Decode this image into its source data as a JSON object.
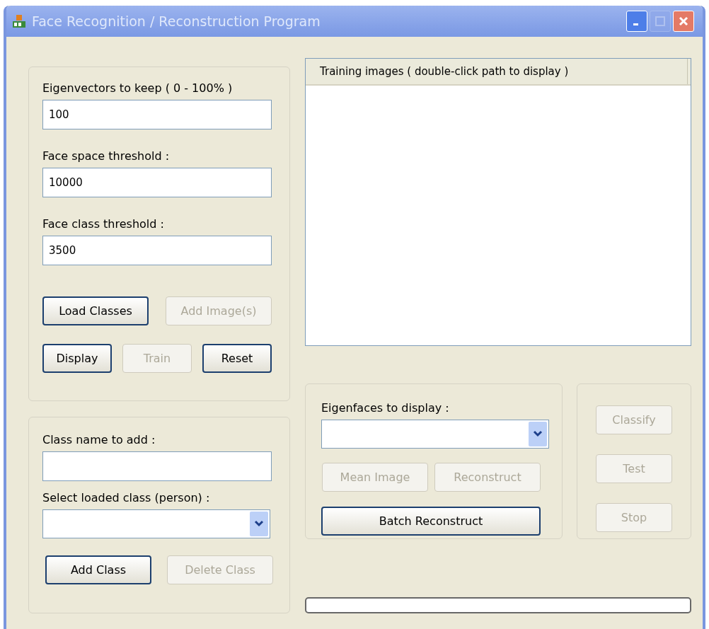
{
  "window": {
    "title": "Face Recognition / Reconstruction Program",
    "controls": [
      {
        "kind": "minimize",
        "disabled": false
      },
      {
        "kind": "maximize",
        "disabled": true
      },
      {
        "kind": "close",
        "disabled": false
      }
    ]
  },
  "settings_group": {
    "fields": [
      {
        "kind": "text",
        "label": "Eigenvectors to keep ( 0 - 100% )",
        "value": "100"
      },
      {
        "kind": "text",
        "label": "Face space threshold :",
        "value": "10000"
      },
      {
        "kind": "text",
        "label": "Face class threshold :",
        "value": "3500"
      }
    ],
    "button_rows": [
      [
        {
          "label": "Load Classes",
          "disabled": false
        },
        {
          "label": "Add Image(s)",
          "disabled": true
        }
      ],
      [
        {
          "label": "Display",
          "disabled": false
        },
        {
          "label": "Train",
          "disabled": true
        },
        {
          "label": "Reset",
          "disabled": false
        }
      ]
    ]
  },
  "class_group": {
    "fields": [
      {
        "kind": "text",
        "label": "Class name to add :"
      },
      {
        "kind": "combo",
        "label": "Select loaded class (person) :"
      }
    ],
    "button_rows": [
      [
        {
          "label": "Add Class",
          "disabled": false
        },
        {
          "label": "Delete Class",
          "disabled": true
        }
      ]
    ]
  },
  "training_list": {
    "columns": [
      "Training images ( double-click path to display )"
    ]
  },
  "eigenface_group": {
    "fields": [
      {
        "kind": "combo",
        "label": "Eigenfaces to display :"
      }
    ],
    "button_rows": [
      [
        {
          "label": "Mean Image",
          "disabled": true
        },
        {
          "label": "Reconstruct",
          "disabled": true
        }
      ],
      [
        {
          "label": "Batch Reconstruct",
          "disabled": false
        }
      ]
    ]
  },
  "classify_group": {
    "buttons": [
      {
        "label": "Classify",
        "disabled": true
      },
      {
        "label": "Test",
        "disabled": true
      },
      {
        "label": "Stop",
        "disabled": true
      }
    ]
  },
  "progress": {
    "level": 0
  }
}
